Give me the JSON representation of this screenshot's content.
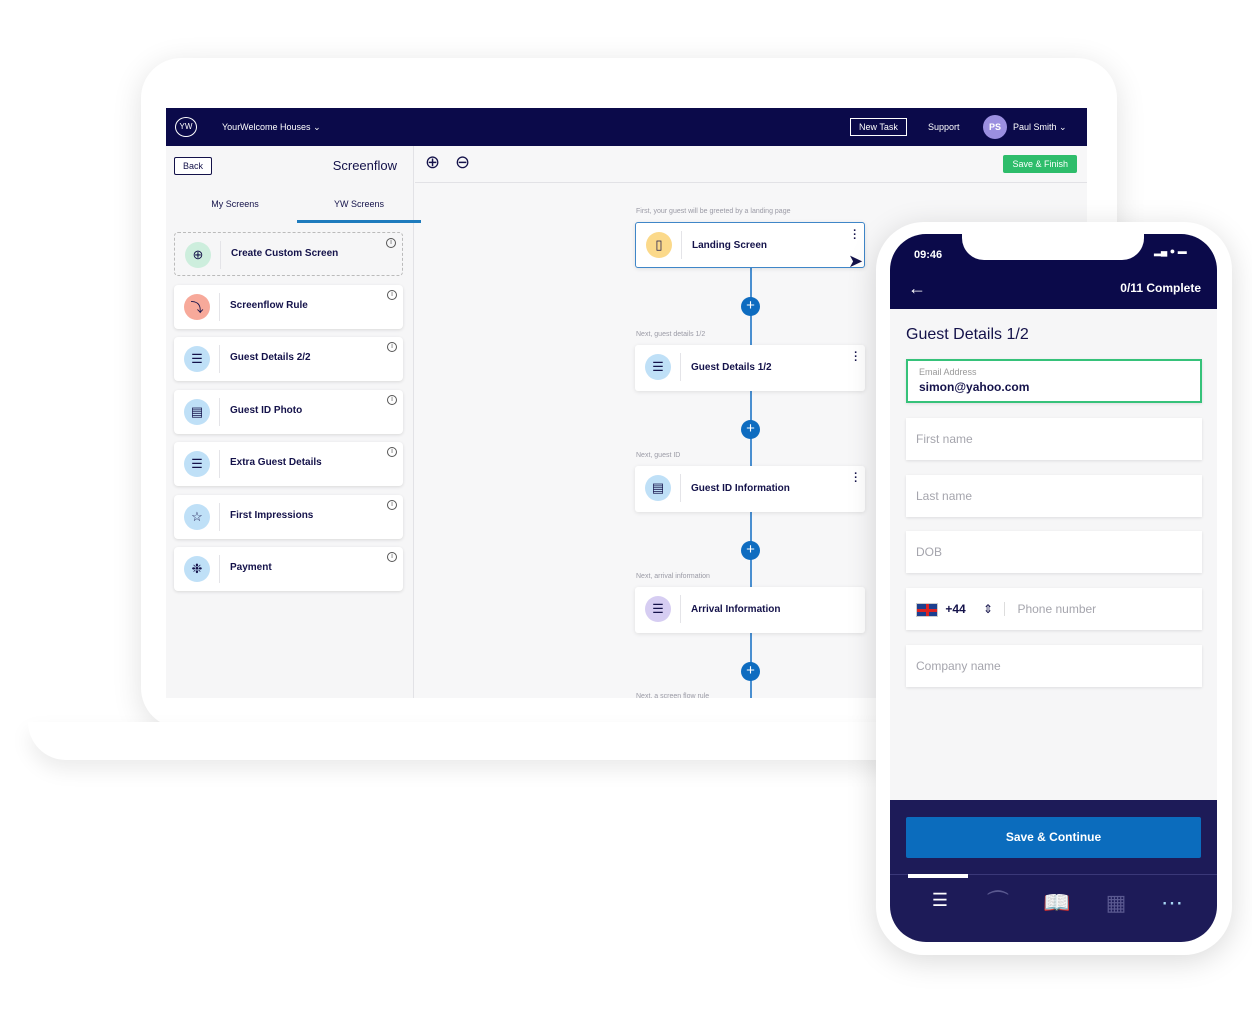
{
  "topbar": {
    "logo": "YW",
    "org": "YourWelcome Houses",
    "new_task": "New Task",
    "support": "Support",
    "avatar": "PS",
    "user": "Paul Smith"
  },
  "left": {
    "back": "Back",
    "title": "Screenflow",
    "tabs": [
      {
        "label": "My Screens"
      },
      {
        "label": "YW Screens",
        "active": true
      }
    ],
    "cards": [
      {
        "label": "Create Custom Screen",
        "icon": "plus-circle-icon",
        "color": "#cdeedd"
      },
      {
        "label": "Screenflow Rule",
        "icon": "split-arrows-icon",
        "color": "#f7a99a"
      },
      {
        "label": "Guest Details 2/2",
        "icon": "list-icon",
        "color": "#bfe0f7"
      },
      {
        "label": "Guest ID Photo",
        "icon": "id-card-icon",
        "color": "#bfe0f7"
      },
      {
        "label": "Extra Guest Details",
        "icon": "list-icon",
        "color": "#bfe0f7"
      },
      {
        "label": "First Impressions",
        "icon": "star-icon",
        "color": "#bfe0f7"
      },
      {
        "label": "Payment",
        "icon": "piggy-bank-icon",
        "color": "#bfe0f7"
      }
    ]
  },
  "toolbar": {
    "save_finish": "Save & Finish"
  },
  "flow": [
    {
      "caption": "First, your guest will be greeted by a landing page",
      "label": "Landing Screen",
      "color": "#fbd98a",
      "icon": "scroll-icon"
    },
    {
      "caption": "Next, guest details 1/2",
      "label": "Guest Details 1/2",
      "color": "#bfe0f7",
      "icon": "list-icon"
    },
    {
      "caption": "Next, guest ID",
      "label": "Guest ID Information",
      "color": "#bfe0f7",
      "icon": "id-card-icon"
    },
    {
      "caption": "Next, arrival information",
      "label": "Arrival Information",
      "color": "#d6cdf2",
      "icon": "list-icon"
    }
  ],
  "flow_last_caption": "Next, a screen flow rule",
  "phone": {
    "time": "09:46",
    "progress": "0/11 Complete",
    "title": "Guest Details 1/2",
    "email_label": "Email Address",
    "email_value": "simon@yahoo.com",
    "first_name": "First name",
    "last_name": "Last name",
    "dob": "DOB",
    "dial_code": "+44",
    "phone": "Phone number",
    "company": "Company name",
    "save": "Save & Continue"
  }
}
